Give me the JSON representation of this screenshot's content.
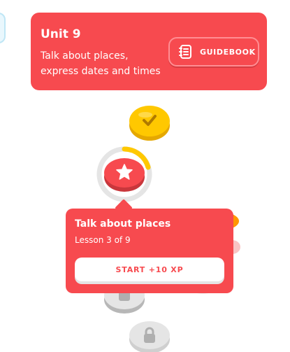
{
  "unit": {
    "title": "Unit 9",
    "description": "Talk about places, express dates and times",
    "guidebook_label": "GUIDEBOOK"
  },
  "path": {
    "nodes": [
      {
        "name": "completed-lesson-node",
        "state": "completed",
        "icon": "check-icon"
      },
      {
        "name": "current-lesson-node",
        "state": "current",
        "icon": "star-icon",
        "progress": 0.33
      },
      {
        "name": "locked-character-node",
        "state": "locked",
        "icon": "character-icon"
      },
      {
        "name": "locked-lesson-node",
        "state": "locked",
        "icon": "lock-icon"
      }
    ]
  },
  "popup": {
    "title": "Talk about places",
    "subtitle": "Lesson 3 of 9",
    "start_label": "START +10 XP"
  },
  "colors": {
    "primary": "#f74a4f",
    "gold": "#ffc800",
    "locked": "#e5e5e5",
    "progress_ring": "#ffc800"
  }
}
